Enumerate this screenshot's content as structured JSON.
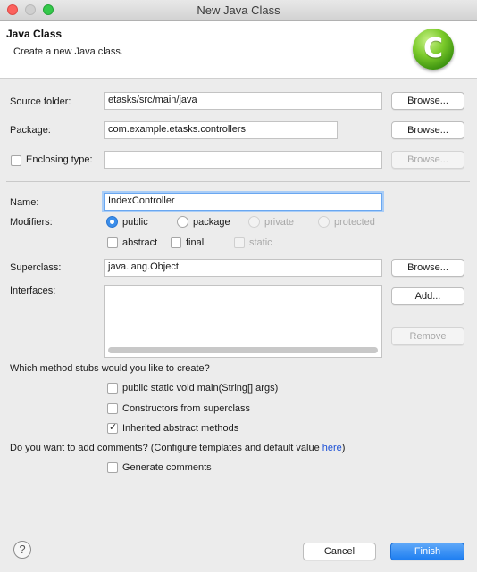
{
  "window": {
    "title": "New Java Class"
  },
  "header": {
    "title": "Java Class",
    "description": "Create a new Java class.",
    "logo_letter": "C"
  },
  "source_folder": {
    "label": "Source folder:",
    "value": "etasks/src/main/java",
    "browse": "Browse..."
  },
  "package": {
    "label": "Package:",
    "value": "com.example.etasks.controllers",
    "browse": "Browse..."
  },
  "enclosing": {
    "label": "Enclosing type:",
    "value": "",
    "browse": "Browse..."
  },
  "name": {
    "label": "Name:",
    "value": "IndexController"
  },
  "modifiers": {
    "label": "Modifiers:",
    "public": "public",
    "package": "package",
    "private": "private",
    "protected": "protected",
    "abstract": "abstract",
    "final": "final",
    "static": "static"
  },
  "superclass": {
    "label": "Superclass:",
    "value": "java.lang.Object",
    "browse": "Browse..."
  },
  "interfaces": {
    "label": "Interfaces:",
    "add": "Add...",
    "remove": "Remove"
  },
  "stubs": {
    "question": "Which method stubs would you like to create?",
    "main": "public static void main(String[] args)",
    "constructors": "Constructors from superclass",
    "inherited": "Inherited abstract methods"
  },
  "comments": {
    "question": "Do you want to add comments? (Configure templates and default value ",
    "link": "here",
    "close": ")",
    "generate": "Generate comments"
  },
  "footer": {
    "help": "?",
    "cancel": "Cancel",
    "finish": "Finish"
  }
}
